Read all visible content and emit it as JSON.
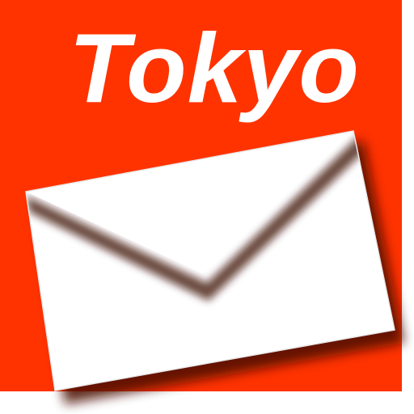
{
  "app_icon": {
    "title": "Tokyo",
    "icon_name": "envelope-icon",
    "colors": {
      "background": "#FF3300",
      "title_text": "#FFFFFF",
      "envelope": "#FFFFFF",
      "envelope_shadow": "#4A0A00"
    }
  }
}
